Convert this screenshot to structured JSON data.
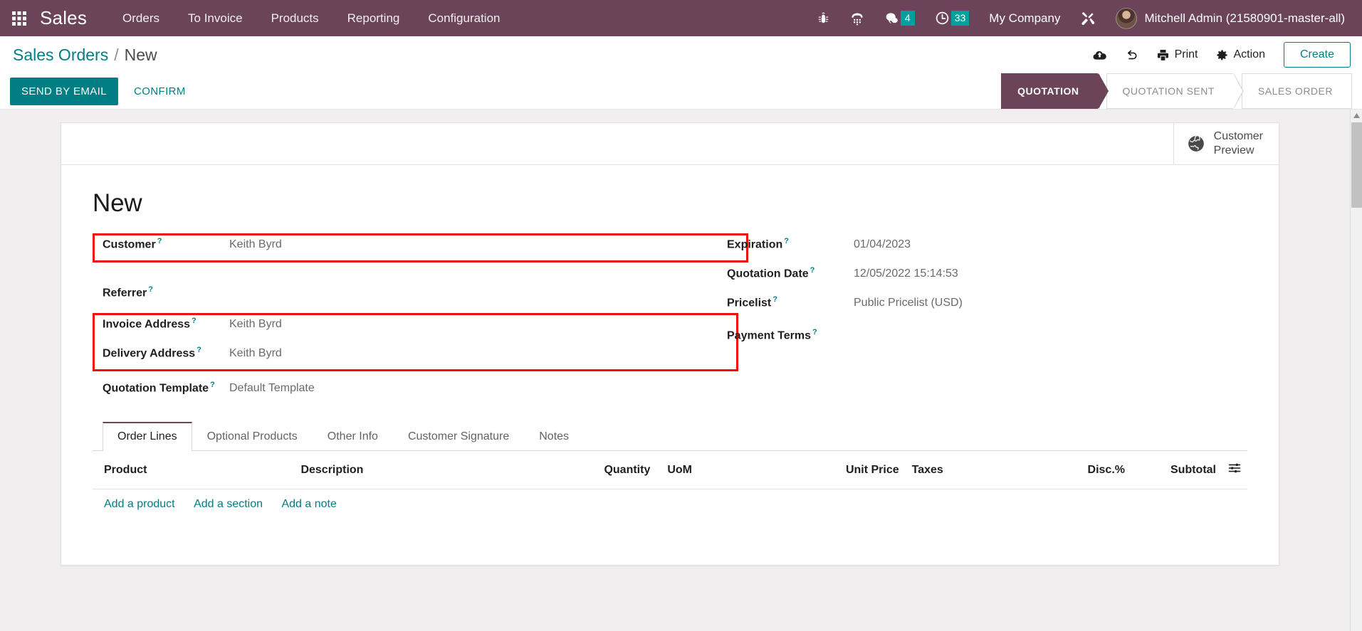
{
  "navbar": {
    "apps_icon": "apps-grid-icon",
    "brand": "Sales",
    "menu": [
      {
        "label": "Orders"
      },
      {
        "label": "To Invoice"
      },
      {
        "label": "Products"
      },
      {
        "label": "Reporting"
      },
      {
        "label": "Configuration"
      }
    ],
    "systray": {
      "bug_icon": "bug-icon",
      "dialpad_icon": "dialpad-icon",
      "messages_icon": "chat-bubble-icon",
      "messages_count": "4",
      "activities_icon": "clock-icon",
      "activities_count": "33",
      "company": "My Company",
      "tools_icon": "tools-icon",
      "avatar": "user-avatar",
      "user": "Mitchell Admin (21580901-master-all)"
    }
  },
  "control_panel": {
    "breadcrumb": {
      "parent": "Sales Orders",
      "separator": "/",
      "current": "New"
    },
    "save_icon": "cloud-upload-icon",
    "discard_icon": "undo-icon",
    "print": {
      "label": "Print",
      "icon": "printer-icon"
    },
    "action": {
      "label": "Action",
      "icon": "gear-icon"
    },
    "create_label": "Create",
    "buttons": {
      "send_by_email": "SEND BY EMAIL",
      "confirm": "CONFIRM"
    },
    "statusbar": [
      {
        "label": "QUOTATION",
        "active": true
      },
      {
        "label": "QUOTATION SENT",
        "active": false
      },
      {
        "label": "SALES ORDER",
        "active": false
      }
    ]
  },
  "sheet": {
    "button_box": {
      "customer_preview": "Customer\nPreview",
      "customer_preview_line1": "Customer",
      "customer_preview_line2": "Preview",
      "globe_icon": "globe-icon"
    },
    "record_title": "New",
    "left_fields": [
      {
        "label": "Customer",
        "value": "Keith Byrd",
        "highlight": true
      },
      {
        "label": "Referrer",
        "value": "",
        "highlight": false
      },
      {
        "label": "Invoice Address",
        "value": "Keith Byrd",
        "highlight": true
      },
      {
        "label": "Delivery Address",
        "value": "Keith Byrd",
        "highlight": true
      },
      {
        "label": "Quotation Template",
        "value": "Default Template",
        "highlight": false
      }
    ],
    "right_fields": [
      {
        "label": "Expiration",
        "value": "01/04/2023"
      },
      {
        "label": "Quotation Date",
        "value": "12/05/2022 15:14:53"
      },
      {
        "label": "Pricelist",
        "value": "Public Pricelist (USD)"
      },
      {
        "label": "Payment Terms",
        "value": ""
      }
    ],
    "help_marker": "?",
    "tabs": [
      {
        "label": "Order Lines",
        "active": true
      },
      {
        "label": "Optional Products",
        "active": false
      },
      {
        "label": "Other Info",
        "active": false
      },
      {
        "label": "Customer Signature",
        "active": false
      },
      {
        "label": "Notes",
        "active": false
      }
    ],
    "lines_table": {
      "columns": [
        "Product",
        "Description",
        "Quantity",
        "UoM",
        "Unit Price",
        "Taxes",
        "Disc.%",
        "Subtotal"
      ],
      "optional_columns_icon": "sliders-icon",
      "rows": [],
      "add_links": [
        "Add a product",
        "Add a section",
        "Add a note"
      ]
    }
  },
  "colors": {
    "navbar_bg": "#6b4459",
    "accent_teal": "#017e84",
    "badge_bg": "#00a09d",
    "highlight_red": "#ee1111",
    "status_active_bg": "#6b4459"
  }
}
